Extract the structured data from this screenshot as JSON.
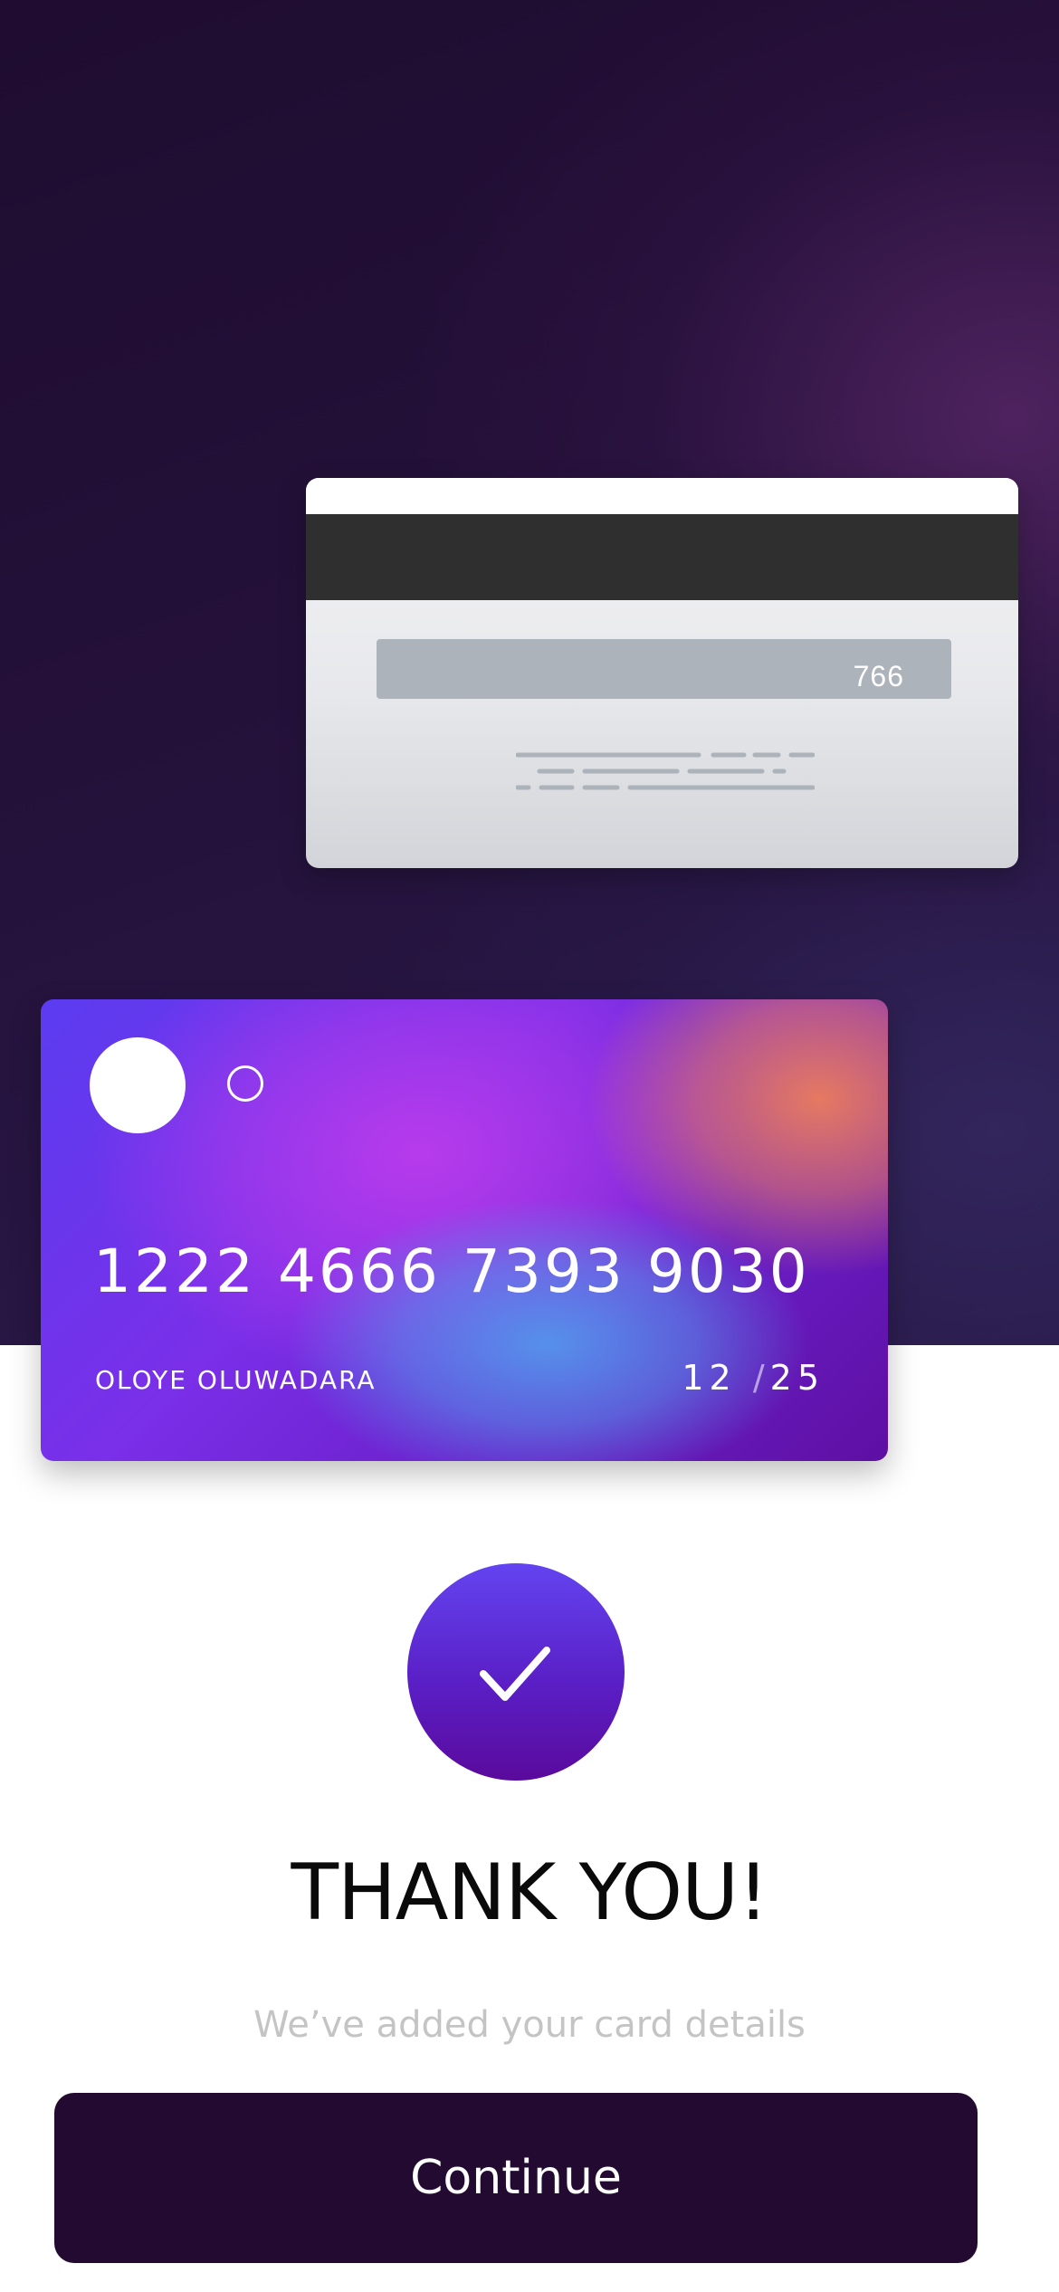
{
  "card_back": {
    "cvv": "766"
  },
  "card_front": {
    "number": "1222 4666 7393 9030",
    "holder_name": "OLOYE OLUWADARA",
    "expiry_month": "12",
    "expiry_separator": "/",
    "expiry_year": "25"
  },
  "success": {
    "icon": "check-icon",
    "title": "THANK YOU!",
    "message": "We’ve added your card details"
  },
  "actions": {
    "continue_label": "Continue"
  },
  "colors": {
    "hero_background": "#24113a",
    "button_background": "#220a30",
    "accent_purple": "#6344f0",
    "card_accent_orange": "#ec7e5c",
    "card_accent_blue": "#5496ec",
    "subtitle_gray": "#c4c4c4"
  }
}
